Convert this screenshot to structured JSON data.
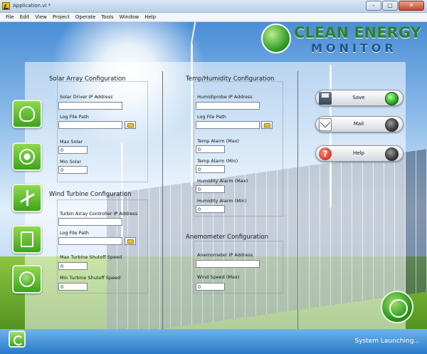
{
  "window": {
    "title": "Application.vi *",
    "minimize": "–",
    "maximize": "□",
    "close": "✕"
  },
  "menu": [
    "File",
    "Edit",
    "View",
    "Project",
    "Operate",
    "Tools",
    "Window",
    "Help"
  ],
  "logo": {
    "line1": "CLEAN ENERGY",
    "line2": "MONITOR"
  },
  "solar": {
    "title": "Solar Array Configuration",
    "driver_ip_label": "Solar Driver IP Address",
    "driver_ip_value": "",
    "log_path_label": "Log File Path",
    "log_path_value": "",
    "max_label": "Max Solar",
    "max_value": "0",
    "min_label": "Min Solar",
    "min_value": "0"
  },
  "wind": {
    "title": "Wind Turbine Configuration",
    "controller_ip_label": "Turbin Array Controller IP Address",
    "controller_ip_value": "",
    "log_path_label": "Log File Path",
    "log_path_value": "",
    "max_shutoff_label": "Max Turbine Shutoff Speed",
    "max_shutoff_value": "0",
    "min_shutoff_label": "Min Turbine Shutoff Speed",
    "min_shutoff_value": "0"
  },
  "temp": {
    "title": "Temp/Humidity Configuration",
    "probe_ip_label": "Humidiprobe IP Address",
    "probe_ip_value": "",
    "log_path_label": "Log File Path",
    "log_path_value": "",
    "temp_max_label": "Temp Alarm (Max)",
    "temp_max_value": "0",
    "temp_min_label": "Temp Alarm (Min)",
    "temp_min_value": "0",
    "hum_max_label": "Humidity Alarm (Max)",
    "hum_max_value": "0",
    "hum_min_label": "Humidity Alarm (Min)",
    "hum_min_value": "0"
  },
  "anemo": {
    "title": "Anemometer Configuration",
    "ip_label": "Anemometer IP Address",
    "ip_value": "",
    "wind_max_label": "Wind Speed (Max)",
    "wind_max_value": "0"
  },
  "actions": {
    "save": "Save",
    "mail": "Mail",
    "help": "Help",
    "save_led": "on",
    "mail_led": "off",
    "help_led": "off"
  },
  "nav": [
    "bulb-icon",
    "sun-icon",
    "wind-turbine-icon",
    "recycle-doc-icon",
    "globe-leaf-icon"
  ],
  "status": {
    "text": "System Launching..."
  }
}
